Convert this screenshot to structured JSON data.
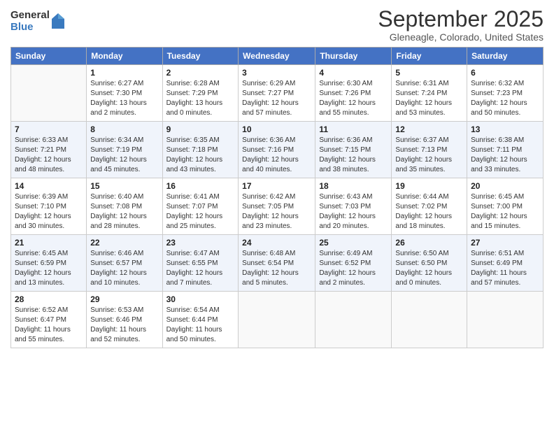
{
  "logo": {
    "general": "General",
    "blue": "Blue"
  },
  "title": "September 2025",
  "subtitle": "Gleneagle, Colorado, United States",
  "weekdays": [
    "Sunday",
    "Monday",
    "Tuesday",
    "Wednesday",
    "Thursday",
    "Friday",
    "Saturday"
  ],
  "weeks": [
    [
      {
        "day": "",
        "sunrise": "",
        "sunset": "",
        "daylight": ""
      },
      {
        "day": "1",
        "sunrise": "Sunrise: 6:27 AM",
        "sunset": "Sunset: 7:30 PM",
        "daylight": "Daylight: 13 hours and 2 minutes."
      },
      {
        "day": "2",
        "sunrise": "Sunrise: 6:28 AM",
        "sunset": "Sunset: 7:29 PM",
        "daylight": "Daylight: 13 hours and 0 minutes."
      },
      {
        "day": "3",
        "sunrise": "Sunrise: 6:29 AM",
        "sunset": "Sunset: 7:27 PM",
        "daylight": "Daylight: 12 hours and 57 minutes."
      },
      {
        "day": "4",
        "sunrise": "Sunrise: 6:30 AM",
        "sunset": "Sunset: 7:26 PM",
        "daylight": "Daylight: 12 hours and 55 minutes."
      },
      {
        "day": "5",
        "sunrise": "Sunrise: 6:31 AM",
        "sunset": "Sunset: 7:24 PM",
        "daylight": "Daylight: 12 hours and 53 minutes."
      },
      {
        "day": "6",
        "sunrise": "Sunrise: 6:32 AM",
        "sunset": "Sunset: 7:23 PM",
        "daylight": "Daylight: 12 hours and 50 minutes."
      }
    ],
    [
      {
        "day": "7",
        "sunrise": "Sunrise: 6:33 AM",
        "sunset": "Sunset: 7:21 PM",
        "daylight": "Daylight: 12 hours and 48 minutes."
      },
      {
        "day": "8",
        "sunrise": "Sunrise: 6:34 AM",
        "sunset": "Sunset: 7:19 PM",
        "daylight": "Daylight: 12 hours and 45 minutes."
      },
      {
        "day": "9",
        "sunrise": "Sunrise: 6:35 AM",
        "sunset": "Sunset: 7:18 PM",
        "daylight": "Daylight: 12 hours and 43 minutes."
      },
      {
        "day": "10",
        "sunrise": "Sunrise: 6:36 AM",
        "sunset": "Sunset: 7:16 PM",
        "daylight": "Daylight: 12 hours and 40 minutes."
      },
      {
        "day": "11",
        "sunrise": "Sunrise: 6:36 AM",
        "sunset": "Sunset: 7:15 PM",
        "daylight": "Daylight: 12 hours and 38 minutes."
      },
      {
        "day": "12",
        "sunrise": "Sunrise: 6:37 AM",
        "sunset": "Sunset: 7:13 PM",
        "daylight": "Daylight: 12 hours and 35 minutes."
      },
      {
        "day": "13",
        "sunrise": "Sunrise: 6:38 AM",
        "sunset": "Sunset: 7:11 PM",
        "daylight": "Daylight: 12 hours and 33 minutes."
      }
    ],
    [
      {
        "day": "14",
        "sunrise": "Sunrise: 6:39 AM",
        "sunset": "Sunset: 7:10 PM",
        "daylight": "Daylight: 12 hours and 30 minutes."
      },
      {
        "day": "15",
        "sunrise": "Sunrise: 6:40 AM",
        "sunset": "Sunset: 7:08 PM",
        "daylight": "Daylight: 12 hours and 28 minutes."
      },
      {
        "day": "16",
        "sunrise": "Sunrise: 6:41 AM",
        "sunset": "Sunset: 7:07 PM",
        "daylight": "Daylight: 12 hours and 25 minutes."
      },
      {
        "day": "17",
        "sunrise": "Sunrise: 6:42 AM",
        "sunset": "Sunset: 7:05 PM",
        "daylight": "Daylight: 12 hours and 23 minutes."
      },
      {
        "day": "18",
        "sunrise": "Sunrise: 6:43 AM",
        "sunset": "Sunset: 7:03 PM",
        "daylight": "Daylight: 12 hours and 20 minutes."
      },
      {
        "day": "19",
        "sunrise": "Sunrise: 6:44 AM",
        "sunset": "Sunset: 7:02 PM",
        "daylight": "Daylight: 12 hours and 18 minutes."
      },
      {
        "day": "20",
        "sunrise": "Sunrise: 6:45 AM",
        "sunset": "Sunset: 7:00 PM",
        "daylight": "Daylight: 12 hours and 15 minutes."
      }
    ],
    [
      {
        "day": "21",
        "sunrise": "Sunrise: 6:45 AM",
        "sunset": "Sunset: 6:59 PM",
        "daylight": "Daylight: 12 hours and 13 minutes."
      },
      {
        "day": "22",
        "sunrise": "Sunrise: 6:46 AM",
        "sunset": "Sunset: 6:57 PM",
        "daylight": "Daylight: 12 hours and 10 minutes."
      },
      {
        "day": "23",
        "sunrise": "Sunrise: 6:47 AM",
        "sunset": "Sunset: 6:55 PM",
        "daylight": "Daylight: 12 hours and 7 minutes."
      },
      {
        "day": "24",
        "sunrise": "Sunrise: 6:48 AM",
        "sunset": "Sunset: 6:54 PM",
        "daylight": "Daylight: 12 hours and 5 minutes."
      },
      {
        "day": "25",
        "sunrise": "Sunrise: 6:49 AM",
        "sunset": "Sunset: 6:52 PM",
        "daylight": "Daylight: 12 hours and 2 minutes."
      },
      {
        "day": "26",
        "sunrise": "Sunrise: 6:50 AM",
        "sunset": "Sunset: 6:50 PM",
        "daylight": "Daylight: 12 hours and 0 minutes."
      },
      {
        "day": "27",
        "sunrise": "Sunrise: 6:51 AM",
        "sunset": "Sunset: 6:49 PM",
        "daylight": "Daylight: 11 hours and 57 minutes."
      }
    ],
    [
      {
        "day": "28",
        "sunrise": "Sunrise: 6:52 AM",
        "sunset": "Sunset: 6:47 PM",
        "daylight": "Daylight: 11 hours and 55 minutes."
      },
      {
        "day": "29",
        "sunrise": "Sunrise: 6:53 AM",
        "sunset": "Sunset: 6:46 PM",
        "daylight": "Daylight: 11 hours and 52 minutes."
      },
      {
        "day": "30",
        "sunrise": "Sunrise: 6:54 AM",
        "sunset": "Sunset: 6:44 PM",
        "daylight": "Daylight: 11 hours and 50 minutes."
      },
      {
        "day": "",
        "sunrise": "",
        "sunset": "",
        "daylight": ""
      },
      {
        "day": "",
        "sunrise": "",
        "sunset": "",
        "daylight": ""
      },
      {
        "day": "",
        "sunrise": "",
        "sunset": "",
        "daylight": ""
      },
      {
        "day": "",
        "sunrise": "",
        "sunset": "",
        "daylight": ""
      }
    ]
  ]
}
